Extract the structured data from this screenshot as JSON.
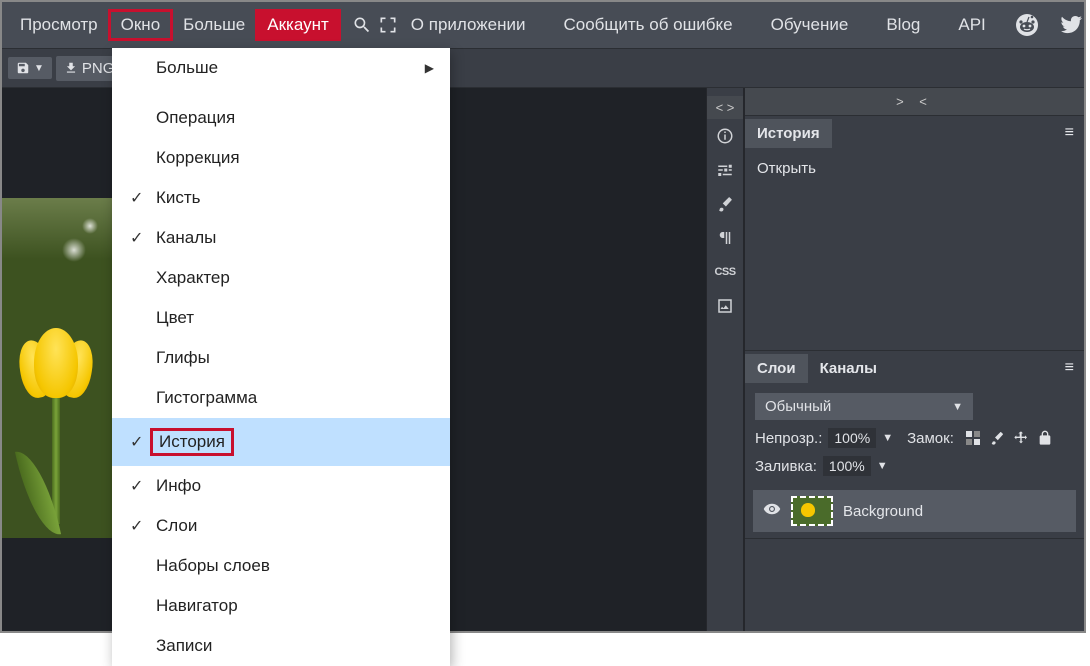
{
  "menubar": {
    "left": [
      "Просмотр",
      "Окно",
      "Больше",
      "Аккаунт"
    ],
    "right": [
      "О приложении",
      "Сообщить об ошибке",
      "Обучение",
      "Blog",
      "API"
    ]
  },
  "toolbar2": {
    "png": "PNG"
  },
  "dropdown": {
    "items": [
      {
        "label": "Больше",
        "sub": true
      },
      {
        "label": "Операция"
      },
      {
        "label": "Коррекция"
      },
      {
        "label": "Кисть",
        "checked": true
      },
      {
        "label": "Каналы",
        "checked": true
      },
      {
        "label": "Характер"
      },
      {
        "label": "Цвет"
      },
      {
        "label": "Глифы"
      },
      {
        "label": "Гистограмма"
      },
      {
        "label": "История",
        "checked": true,
        "hovered": true,
        "boxed": true
      },
      {
        "label": "Инфо",
        "checked": true
      },
      {
        "label": "Слои",
        "checked": true
      },
      {
        "label": "Наборы слоев"
      },
      {
        "label": "Навигатор"
      },
      {
        "label": "Записи"
      }
    ]
  },
  "strip": {
    "head": "< >",
    "css": "CSS"
  },
  "rightHead": "> <",
  "history": {
    "tab": "История",
    "entry": "Открыть"
  },
  "layers": {
    "tab1": "Слои",
    "tab2": "Каналы",
    "blend": "Обычный",
    "opacityLabel": "Непрозр.:",
    "opacityVal": "100%",
    "lockLabel": "Замок:",
    "fillLabel": "Заливка:",
    "fillVal": "100%",
    "layerName": "Background"
  }
}
